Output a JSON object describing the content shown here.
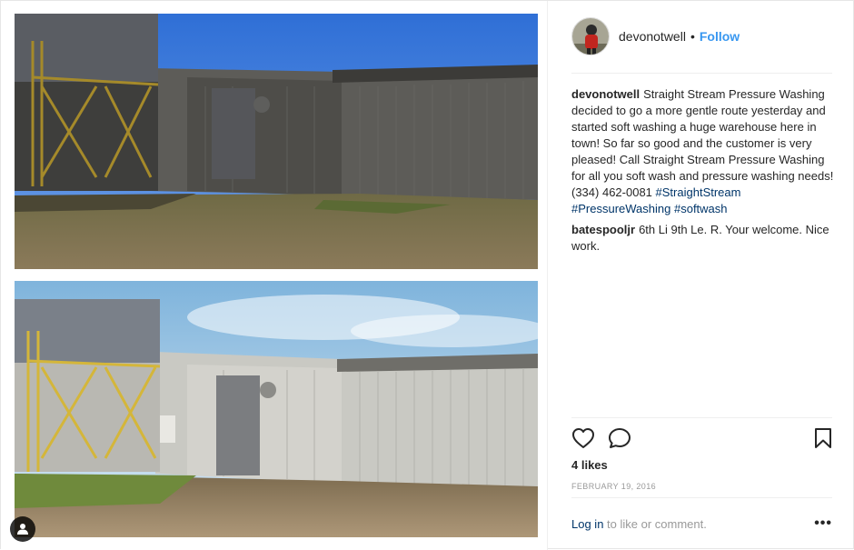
{
  "post": {
    "header": {
      "username": "devonotwell",
      "separator": "•",
      "follow_label": "Follow"
    },
    "caption": {
      "author": "devonotwell",
      "text": "Straight Stream Pressure Washing decided to go a more gentle route yesterday and started soft washing a huge warehouse here in town! So far so good and the customer is very pleased! Call Straight Stream Pressure Washing for all you soft wash and pressure washing needs! (334) 462-0081",
      "hashtags": [
        "#StraightStream",
        "#PressureWashing",
        "#softwash"
      ]
    },
    "comments": [
      {
        "author": "batespooljr",
        "text": "6th Li 9th Le. R. Your welcome. Nice work."
      }
    ],
    "likes": "4 likes",
    "date": "FEBRUARY 19, 2016",
    "footer": {
      "login_label": "Log in",
      "login_suffix": "to like or comment.",
      "more_label": "•••"
    },
    "icons": {
      "like": "heart-icon",
      "comment": "comment-icon",
      "save": "bookmark-icon",
      "tag": "user-tag-icon"
    },
    "colors": {
      "link": "#3897f0",
      "hashtag": "#003569",
      "muted": "#999999",
      "text": "#262626"
    }
  }
}
